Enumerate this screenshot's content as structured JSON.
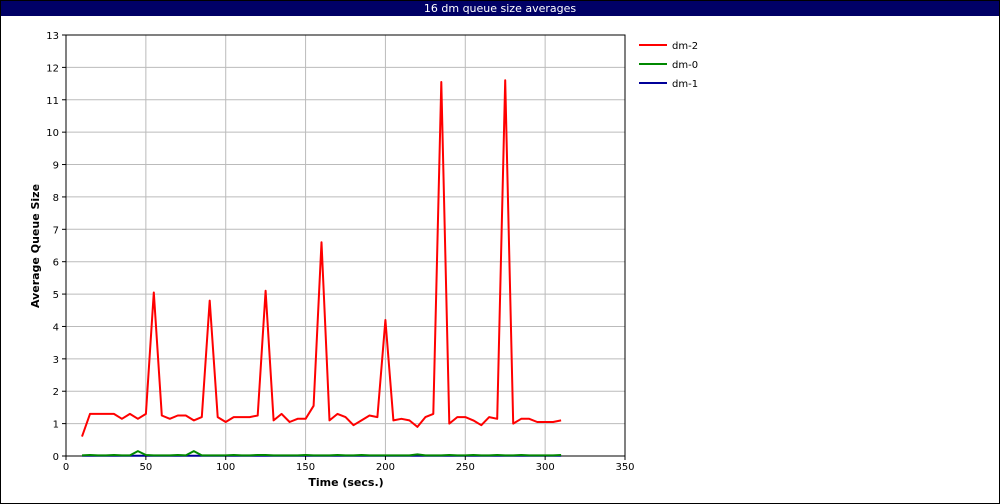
{
  "window": {
    "title": "16 dm queue size averages"
  },
  "chart_data": {
    "type": "line",
    "title": "16 dm queue size averages",
    "xlabel": "Time (secs.)",
    "ylabel": "Average Queue Size",
    "xlim": [
      0,
      350
    ],
    "ylim": [
      0,
      13
    ],
    "x_ticks": [
      0,
      50,
      100,
      150,
      200,
      250,
      300,
      350
    ],
    "y_ticks": [
      0,
      1,
      2,
      3,
      4,
      5,
      6,
      7,
      8,
      9,
      10,
      11,
      12,
      13
    ],
    "grid": true,
    "legend_position": "right",
    "series": [
      {
        "name": "dm-2",
        "color": "#ff0000",
        "x": [
          10,
          15,
          20,
          25,
          30,
          35,
          40,
          45,
          50,
          55,
          60,
          65,
          70,
          75,
          80,
          85,
          90,
          95,
          100,
          105,
          110,
          115,
          120,
          125,
          130,
          135,
          140,
          145,
          150,
          155,
          160,
          165,
          170,
          175,
          180,
          185,
          190,
          195,
          200,
          205,
          210,
          215,
          220,
          225,
          230,
          235,
          240,
          245,
          250,
          255,
          260,
          265,
          270,
          275,
          280,
          285,
          290,
          295,
          300,
          305,
          310
        ],
        "y": [
          0.6,
          1.3,
          1.3,
          1.3,
          1.3,
          1.15,
          1.3,
          1.15,
          1.3,
          5.05,
          1.25,
          1.15,
          1.25,
          1.25,
          1.1,
          1.2,
          4.8,
          1.2,
          1.05,
          1.2,
          1.2,
          1.2,
          1.25,
          5.1,
          1.1,
          1.3,
          1.05,
          1.15,
          1.15,
          1.55,
          6.6,
          1.1,
          1.3,
          1.2,
          0.95,
          1.1,
          1.25,
          1.2,
          4.2,
          1.1,
          1.15,
          1.1,
          0.9,
          1.2,
          1.3,
          11.55,
          1.0,
          1.2,
          1.2,
          1.1,
          0.95,
          1.2,
          1.15,
          11.6,
          1.0,
          1.15,
          1.15,
          1.05,
          1.05,
          1.05,
          1.1
        ]
      },
      {
        "name": "dm-0",
        "color": "#008800",
        "x": [
          10,
          15,
          20,
          25,
          30,
          35,
          40,
          45,
          50,
          55,
          60,
          65,
          70,
          75,
          80,
          85,
          90,
          95,
          100,
          105,
          110,
          115,
          120,
          125,
          130,
          135,
          140,
          145,
          150,
          155,
          160,
          165,
          170,
          175,
          180,
          185,
          190,
          195,
          200,
          205,
          210,
          215,
          220,
          225,
          230,
          235,
          240,
          245,
          250,
          255,
          260,
          265,
          270,
          275,
          280,
          285,
          290,
          295,
          300,
          305,
          310
        ],
        "y": [
          0.02,
          0.03,
          0.02,
          0.02,
          0.03,
          0.02,
          0.02,
          0.15,
          0.03,
          0.02,
          0.02,
          0.02,
          0.03,
          0.02,
          0.15,
          0.02,
          0.02,
          0.02,
          0.02,
          0.03,
          0.02,
          0.02,
          0.03,
          0.03,
          0.02,
          0.02,
          0.02,
          0.02,
          0.03,
          0.02,
          0.02,
          0.02,
          0.03,
          0.02,
          0.02,
          0.03,
          0.02,
          0.02,
          0.02,
          0.02,
          0.02,
          0.02,
          0.05,
          0.02,
          0.02,
          0.02,
          0.03,
          0.02,
          0.02,
          0.03,
          0.02,
          0.02,
          0.03,
          0.02,
          0.02,
          0.03,
          0.02,
          0.02,
          0.02,
          0.02,
          0.03
        ]
      },
      {
        "name": "dm-1",
        "color": "#000099",
        "x": [
          10,
          20,
          30,
          40,
          50,
          60,
          70,
          80,
          90,
          100,
          110,
          120,
          130,
          140,
          150,
          160,
          170,
          180,
          190,
          200,
          210,
          220,
          230,
          240,
          250,
          260,
          270,
          280,
          290,
          300,
          310
        ],
        "y": [
          0.01,
          0.01,
          0.01,
          0.01,
          0.01,
          0.01,
          0.01,
          0.01,
          0.01,
          0.01,
          0.01,
          0.01,
          0.01,
          0.01,
          0.01,
          0.01,
          0.01,
          0.01,
          0.01,
          0.01,
          0.01,
          0.01,
          0.01,
          0.01,
          0.01,
          0.01,
          0.01,
          0.01,
          0.01,
          0.01,
          0.01
        ]
      }
    ]
  }
}
